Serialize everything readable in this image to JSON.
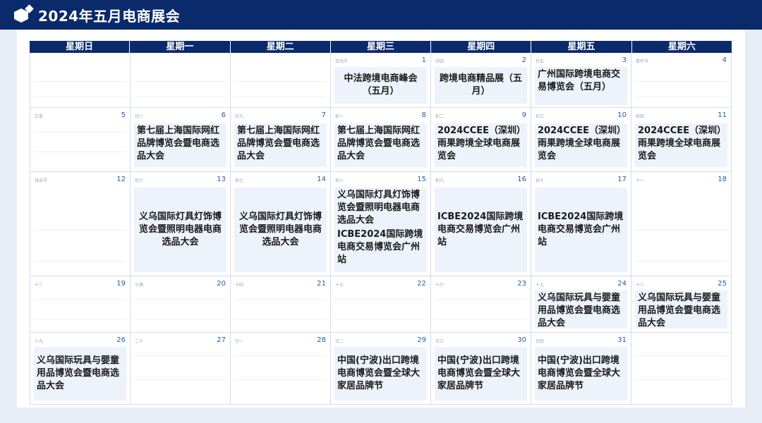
{
  "header": {
    "title": "2024年五月电商展会"
  },
  "weekdays": [
    "星期日",
    "星期一",
    "星期二",
    "星期三",
    "星期四",
    "星期五",
    "星期六"
  ],
  "weeks": [
    [
      {
        "day": "",
        "lunar": "",
        "events": []
      },
      {
        "day": "",
        "lunar": "",
        "events": []
      },
      {
        "day": "",
        "lunar": "",
        "events": []
      },
      {
        "day": "1",
        "lunar": "劳动节",
        "events": [
          "中法跨境电商峰会（五月）"
        ]
      },
      {
        "day": "2",
        "lunar": "廿四",
        "events": [
          "跨境电商精品展（五月）"
        ]
      },
      {
        "day": "3",
        "lunar": "廿五",
        "events": [
          "广州国际跨境电商交易博览会（五月）"
        ]
      },
      {
        "day": "4",
        "lunar": "青年节",
        "events": []
      }
    ],
    [
      {
        "day": "5",
        "lunar": "立夏",
        "events": []
      },
      {
        "day": "6",
        "lunar": "廿八",
        "events": [
          "第七届上海国际网红品牌博览会暨电商选品大会"
        ]
      },
      {
        "day": "7",
        "lunar": "廿九",
        "events": [
          "第七届上海国际网红品牌博览会暨电商选品大会"
        ]
      },
      {
        "day": "8",
        "lunar": "初一",
        "events": [
          "第七届上海国际网红品牌博览会暨电商选品大会"
        ]
      },
      {
        "day": "9",
        "lunar": "初二",
        "events": [
          "2024CCEE（深圳）雨果跨境全球电商展览会"
        ]
      },
      {
        "day": "10",
        "lunar": "初三",
        "events": [
          "2024CCEE（深圳）雨果跨境全球电商展览会"
        ]
      },
      {
        "day": "11",
        "lunar": "初四",
        "events": [
          "2024CCEE（深圳）雨果跨境全球电商展览会"
        ]
      }
    ],
    [
      {
        "day": "12",
        "lunar": "母亲节",
        "events": []
      },
      {
        "day": "13",
        "lunar": "初六",
        "events": [
          "义乌国际灯具灯饰博览会暨照明电器电商选品大会"
        ]
      },
      {
        "day": "14",
        "lunar": "初七",
        "events": [
          "义乌国际灯具灯饰博览会暨照明电器电商选品大会"
        ]
      },
      {
        "day": "15",
        "lunar": "初八",
        "events": [
          "义乌国际灯具灯饰博览会暨照明电器电商选品大会",
          "ICBE2024国际跨境电商交易博览会广州站"
        ]
      },
      {
        "day": "16",
        "lunar": "初九",
        "events": [
          "ICBE2024国际跨境电商交易博览会广州站"
        ]
      },
      {
        "day": "17",
        "lunar": "初十",
        "events": [
          "ICBE2024国际跨境电商交易博览会广州站"
        ]
      },
      {
        "day": "18",
        "lunar": "十一",
        "events": []
      }
    ],
    [
      {
        "day": "19",
        "lunar": "十二",
        "events": []
      },
      {
        "day": "20",
        "lunar": "小满",
        "events": []
      },
      {
        "day": "21",
        "lunar": "十四",
        "events": []
      },
      {
        "day": "22",
        "lunar": "十五",
        "events": []
      },
      {
        "day": "23",
        "lunar": "十六",
        "events": []
      },
      {
        "day": "24",
        "lunar": "十七",
        "events": [
          "义乌国际玩具与婴童用品博览会暨电商选品大会"
        ]
      },
      {
        "day": "25",
        "lunar": "十八",
        "events": [
          "义乌国际玩具与婴童用品博览会暨电商选品大会"
        ]
      }
    ],
    [
      {
        "day": "26",
        "lunar": "十九",
        "events": [
          "义乌国际玩具与婴童用品博览会暨电商选品大会"
        ]
      },
      {
        "day": "27",
        "lunar": "二十",
        "events": []
      },
      {
        "day": "28",
        "lunar": "廿一",
        "events": []
      },
      {
        "day": "29",
        "lunar": "廿二",
        "events": [
          "中国(宁波)出口跨境电商博览会暨全球大家居品牌节"
        ]
      },
      {
        "day": "30",
        "lunar": "廿三",
        "events": [
          "中国(宁波)出口跨境电商博览会暨全球大家居品牌节"
        ]
      },
      {
        "day": "31",
        "lunar": "廿四",
        "events": [
          "中国(宁波)出口跨境电商博览会暨全球大家居品牌节"
        ]
      },
      {
        "day": "",
        "lunar": "",
        "events": []
      }
    ]
  ]
}
